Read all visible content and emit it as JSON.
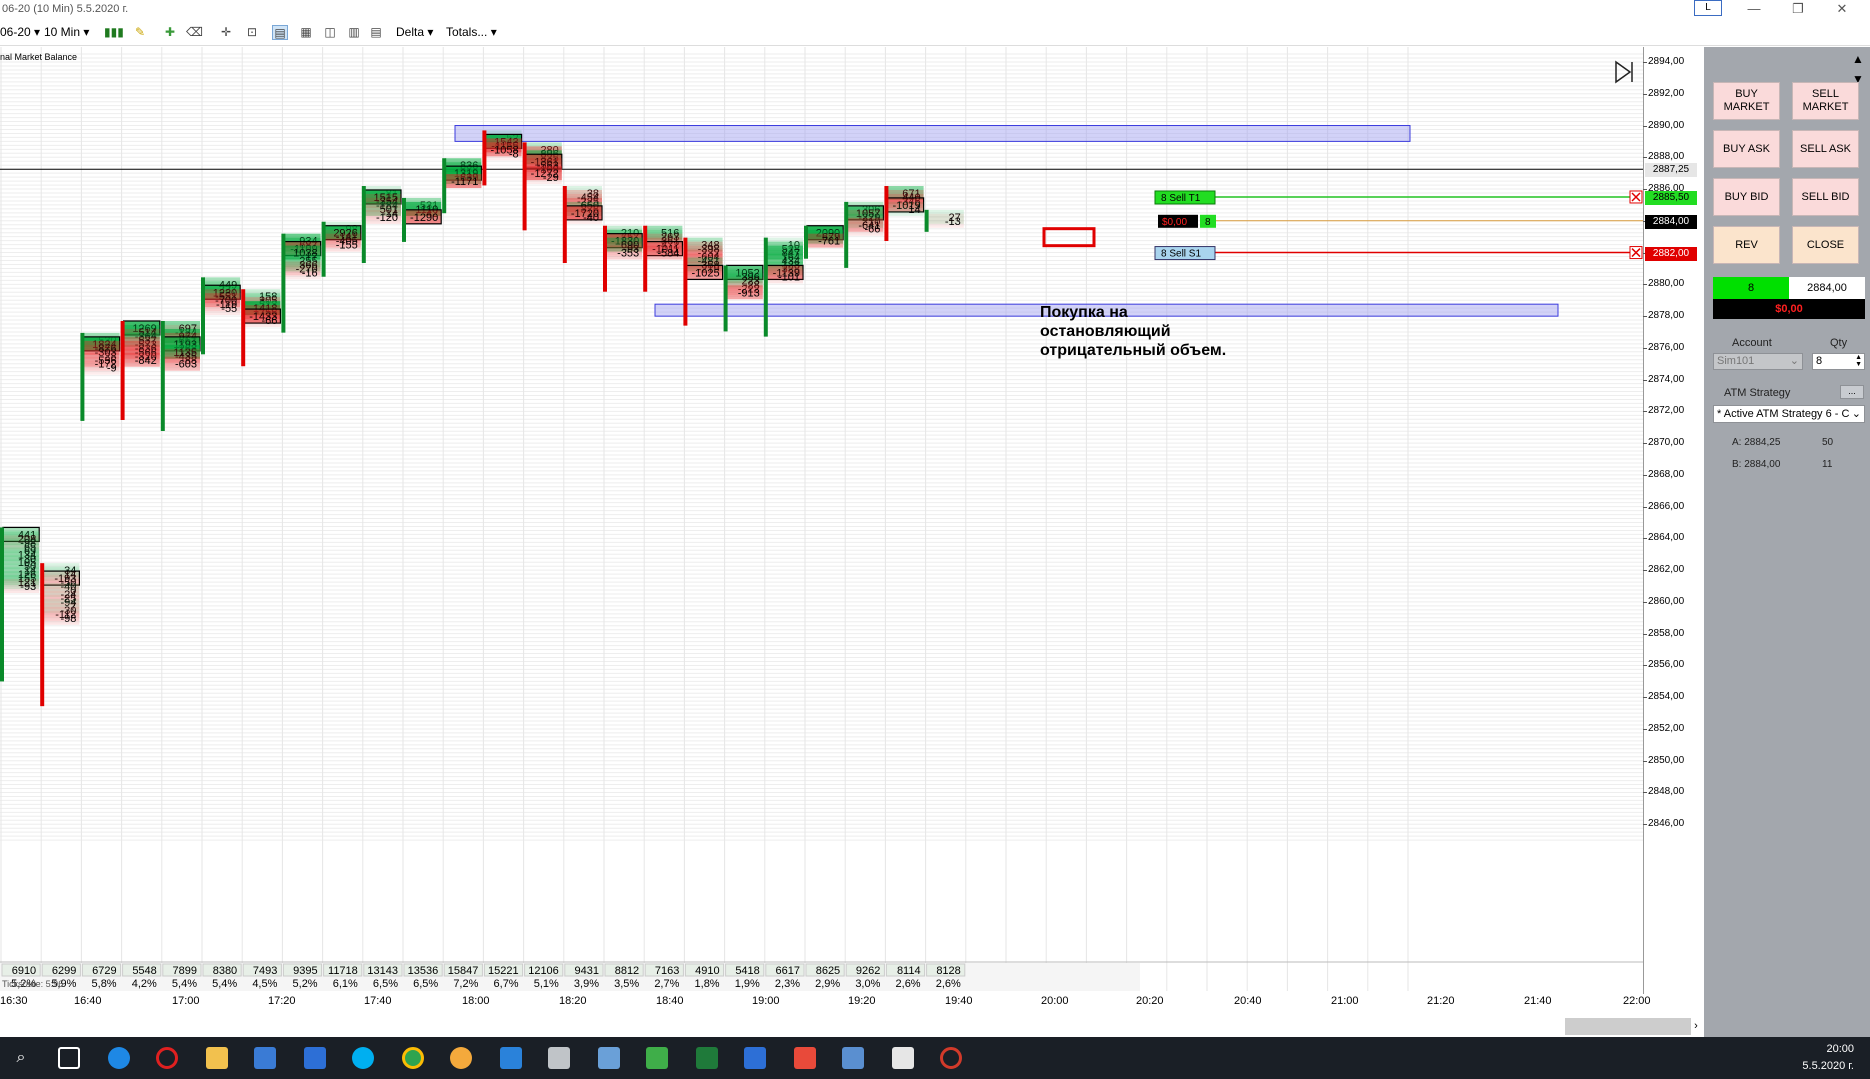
{
  "window": {
    "title": "06-20 (10 Min)  5.5.2020 г.",
    "layout_button": "L"
  },
  "toolbar": {
    "instrument": "06-20",
    "interval": "10 Min",
    "delta_label": "Delta",
    "totals_label": "Totals..."
  },
  "indicator_label": "nal Market Balance",
  "colors": {
    "buy": "#00a651",
    "sell": "#e00000",
    "zone": "#9b9bf0",
    "panel": "#a3a7ad"
  },
  "price_axis": {
    "ticks": [
      "2894,00",
      "2892,00",
      "2890,00",
      "2888,00",
      "2886,00",
      "2884,00",
      "2882,00",
      "2880,00",
      "2878,00",
      "2876,00",
      "2874,00",
      "2872,00",
      "2870,00",
      "2868,00",
      "2866,00",
      "2864,00",
      "2862,00",
      "2860,00",
      "2858,00",
      "2856,00",
      "2854,00",
      "2852,00",
      "2850,00",
      "2848,00",
      "2846,00"
    ],
    "tags": {
      "last": "2887,25",
      "target": "2885,50",
      "current": "2884,00",
      "stop": "2882,00"
    }
  },
  "time_axis": [
    "16:30",
    "16:40",
    "17:00",
    "17:20",
    "17:40",
    "18:00",
    "18:20",
    "18:40",
    "19:00",
    "19:20",
    "19:40",
    "20:00",
    "20:20",
    "20:40",
    "21:00",
    "21:20",
    "21:40",
    "22:00"
  ],
  "footer": {
    "volume": [
      "6910",
      "6299",
      "6729",
      "5548",
      "7899",
      "8380",
      "7493",
      "9395",
      "11718",
      "13143",
      "13536",
      "15847",
      "15221",
      "12106",
      "9431",
      "8812",
      "7163",
      "4910",
      "5418",
      "6617",
      "8625",
      "9262",
      "8114",
      "8128"
    ],
    "pct": [
      "5,2%",
      "5,9%",
      "5,8%",
      "4,2%",
      "5,4%",
      "5,4%",
      "4,5%",
      "5,2%",
      "6,1%",
      "6,5%",
      "6,5%",
      "7,2%",
      "6,7%",
      "5,1%",
      "3,9%",
      "3,5%",
      "2,7%",
      "1,8%",
      "1,9%",
      "2,3%",
      "2,9%",
      "3,0%",
      "2,6%",
      "2,6%"
    ],
    "overlay_label": "Ticksrade: 5:96"
  },
  "chart_data": {
    "type": "table",
    "description_series": "Order flow footprint: delta per price per 10-min bar",
    "columns": [
      {
        "time": "16:30a",
        "top": 2864.25,
        "cells": [
          441,
          208,
          -98,
          65,
          69,
          134,
          30,
          105,
          50,
          14,
          126,
          155,
          121,
          -93
        ]
      },
      {
        "time": "16:30b",
        "top": 2862.0,
        "cells": [
          34,
          14,
          -193,
          -50,
          -40,
          0,
          -24,
          -25,
          -94,
          7,
          -30,
          -112,
          -98
        ]
      },
      {
        "time": "16:40",
        "top": 2876.5,
        "cells": [
          530,
          1824,
          -876,
          -303,
          -28,
          -536,
          -172,
          -9
        ]
      },
      {
        "time": "16:50",
        "top": 2877.25,
        "cells": [
          1269,
          514,
          -364,
          537,
          -573,
          -836,
          -566,
          -320,
          -842
        ]
      },
      {
        "time": "17:00",
        "top": 2877.25,
        "cells": [
          697,
          -124,
          974,
          -661,
          1193,
          263,
          1135,
          -435,
          -88,
          -603
        ]
      },
      {
        "time": "17:10",
        "top": 2880.0,
        "cells": [
          449,
          227,
          1230,
          -551,
          -700,
          -119,
          -55
        ]
      },
      {
        "time": "17:20",
        "top": 2879.25,
        "cells": [
          158,
          305,
          -513,
          1418,
          -756,
          -1433,
          -66
        ]
      },
      {
        "time": "17:30",
        "top": 2882.75,
        "cells": [
          934,
          687,
          -1109,
          1038,
          17,
          255,
          366,
          -270,
          -16
        ]
      },
      {
        "time": "17:40",
        "top": 2883.5,
        "cells": [
          98,
          2926,
          -141,
          -405,
          -155
        ]
      },
      {
        "time": "17:50",
        "top": 2885.75,
        "cells": [
          81,
          1515,
          -354,
          -184,
          501,
          -14,
          -120
        ]
      },
      {
        "time": "18:00",
        "top": 2885.0,
        "cells": [
          531,
          1110,
          42,
          -1290
        ]
      },
      {
        "time": "18:10",
        "top": 2887.5,
        "cells": [
          836,
          688,
          1319,
          639,
          -1171
        ]
      },
      {
        "time": "18:20",
        "top": 2889.25,
        "cells": [
          52,
          1543,
          -1155,
          -1058,
          -8
        ]
      },
      {
        "time": "18:30",
        "top": 2888.5,
        "cells": [
          280,
          -896,
          835,
          -1361,
          -563,
          -109,
          -1272,
          -29
        ]
      },
      {
        "time": "18:40",
        "top": 2885.75,
        "cells": [
          38,
          -454,
          -225,
          -650,
          376,
          -1720,
          -40
        ]
      },
      {
        "time": "18:50",
        "top": 2883.25,
        "cells": [
          210,
          757,
          -1830,
          690,
          -93,
          -353
        ]
      },
      {
        "time": "19:00",
        "top": 2883.25,
        "cells": [
          516,
          263,
          -361,
          -472,
          -1011,
          -584
        ]
      },
      {
        "time": "19:10",
        "top": 2882.5,
        "cells": [
          348,
          -398,
          -232,
          -604,
          -481,
          358,
          -219,
          -1025
        ]
      },
      {
        "time": "19:20",
        "top": 2880.75,
        "cells": [
          1052,
          396,
          223,
          -28,
          -222,
          -913
        ]
      },
      {
        "time": "19:30",
        "top": 2882.5,
        "cells": [
          10,
          528,
          847,
          164,
          434,
          128,
          328,
          -1139,
          -101
        ]
      },
      {
        "time": "19:40",
        "top": 2883.25,
        "cells": [
          2090,
          679,
          -761
        ]
      },
      {
        "time": "19:50",
        "top": 2884.75,
        "cells": [
          306,
          1057,
          -229,
          210,
          -641,
          -66
        ]
      },
      {
        "time": "20:00",
        "top": 2885.75,
        "cells": [
          671,
          -440,
          -346,
          -1019,
          14
        ]
      },
      {
        "time": "20:10",
        "top": 2884.25,
        "cells": [
          27,
          -13
        ]
      }
    ],
    "zones": [
      {
        "from": 2889.0,
        "to": 2890.0
      },
      {
        "from": 2878.0,
        "to": 2878.75
      }
    ]
  },
  "orders": {
    "target": "8  Sell T1",
    "stop": "8  Sell S1",
    "pnl": "$0,00",
    "qty": "8"
  },
  "annotation": [
    "Покупка на",
    "остановляющий",
    "отрицательный объем."
  ],
  "panel": {
    "buy_market": "BUY\nMARKET",
    "sell_market": "SELL\nMARKET",
    "buy_ask": "BUY ASK",
    "sell_ask": "SELL ASK",
    "buy_bid": "BUY BID",
    "sell_bid": "SELL BID",
    "rev": "REV",
    "close": "CLOSE",
    "position_qty": "8",
    "position_price": "2884,00",
    "pnl": "$0,00",
    "account_label": "Account",
    "qty_label": "Qty",
    "account_value": "Sim101",
    "qty_value": "8",
    "atm_label": "ATM Strategy",
    "atm_value": "* Active ATM Strategy 6 - C",
    "ask_line": "A: 2884,25",
    "ask_size": "50",
    "bid_line": "B: 2884,00",
    "bid_size": "11"
  },
  "clock": {
    "time": "20:00",
    "date": "5.5.2020 г."
  }
}
